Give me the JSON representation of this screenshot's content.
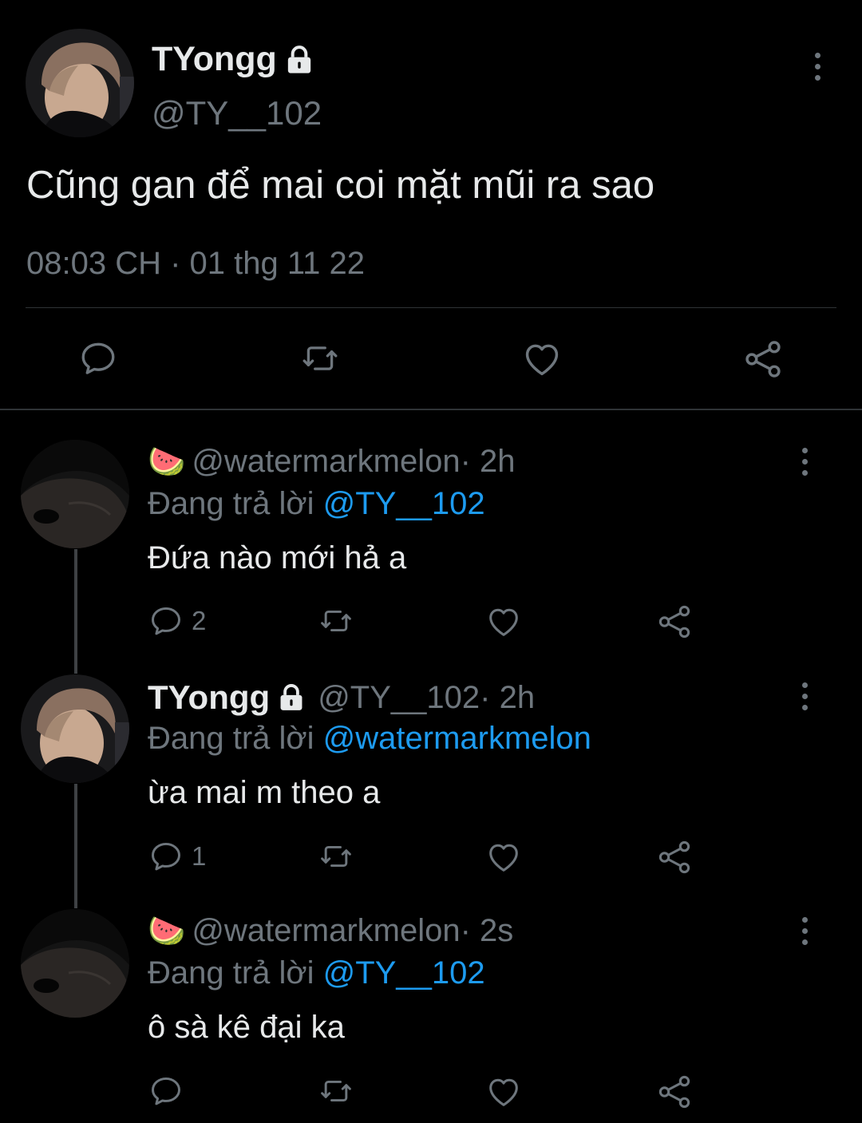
{
  "main_tweet": {
    "display_name": "TYongg",
    "handle": "@TY__102",
    "text": "Cũng gan để mai coi mặt mũi ra sao",
    "timestamp": "08:03 CH · 01 thg 11 22"
  },
  "replies": [
    {
      "emoji": "🍉",
      "handle": "@watermarkmelon",
      "time": " · 2h",
      "replying_to_label": "Đang trả lời",
      "replying_to": "@TY__102",
      "text": "Đứa nào mới hả a",
      "reply_count": "2"
    },
    {
      "display_name": "TYongg",
      "handle": "@TY__102",
      "time": " · 2h",
      "replying_to_label": "Đang trả lời",
      "replying_to": "@watermarkmelon",
      "text": "ừa mai m theo a",
      "reply_count": "1"
    },
    {
      "emoji": "🍉",
      "handle": "@watermarkmelon",
      "time": " · 2s",
      "replying_to_label": "Đang trả lời",
      "replying_to": "@TY__102",
      "text": "ô sà kê đại ka",
      "reply_count": ""
    }
  ],
  "icons": {
    "reply": "reply-icon",
    "retweet": "retweet-icon",
    "like": "like-icon",
    "share": "share-icon",
    "more": "more-vertical-icon",
    "lock": "lock-icon"
  },
  "colors": {
    "background": "#000000",
    "text": "#e7e9ea",
    "muted": "#6e767d",
    "link": "#1d9bf0",
    "divider": "#2f3336"
  }
}
